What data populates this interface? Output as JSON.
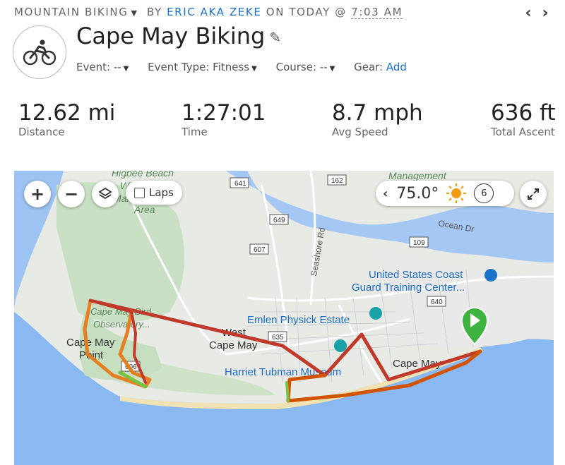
{
  "header": {
    "activity_type": "MOUNTAIN BIKING",
    "by_prefix": "BY",
    "author": "ERIC AKA ZEKE",
    "on_text": "ON TODAY @",
    "time": "7:03 AM"
  },
  "activity": {
    "title": "Cape May Biking",
    "icon": "bike-icon",
    "event_label": "Event:",
    "event_value": "--",
    "event_type_label": "Event Type:",
    "event_type_value": "Fitness",
    "course_label": "Course:",
    "course_value": "--",
    "gear_label": "Gear:",
    "gear_value": "Add"
  },
  "stats": [
    {
      "value": "12.62 mi",
      "label": "Distance"
    },
    {
      "value": "1:27:01",
      "label": "Time"
    },
    {
      "value": "8.7 mph",
      "label": "Avg Speed"
    },
    {
      "value": "636 ft",
      "label": "Total Ascent"
    }
  ],
  "map": {
    "laps_label": "Laps",
    "temperature": "75.0°",
    "wind": "6",
    "labels": {
      "higbee": "Higbee Beach",
      "wildlife": "Wildlife",
      "management_area": "Management",
      "area": "Area",
      "management_top": "Management",
      "ocean_dr": "Ocean Dr",
      "seashore_rd": "Seashore Rd",
      "coast_guard_1": "United States Coast",
      "coast_guard_2": "Guard Training Center...",
      "emlen": "Emlen Physick Estate",
      "west_cape_may_1": "West",
      "west_cape_may_2": "Cape May",
      "harriet": "Harriet Tubman Museum",
      "cape_may_point_1": "Cape May",
      "cape_may_point_2": "Point",
      "cape_may": "Cape May",
      "bird_obs_1": "Cape May Bird",
      "bird_obs_2": "Observatory..."
    },
    "shields": {
      "s641": "641",
      "s162": "162",
      "s649": "649",
      "s607": "607",
      "s109": "109",
      "s640": "640",
      "s635": "635",
      "s606": "606"
    }
  }
}
